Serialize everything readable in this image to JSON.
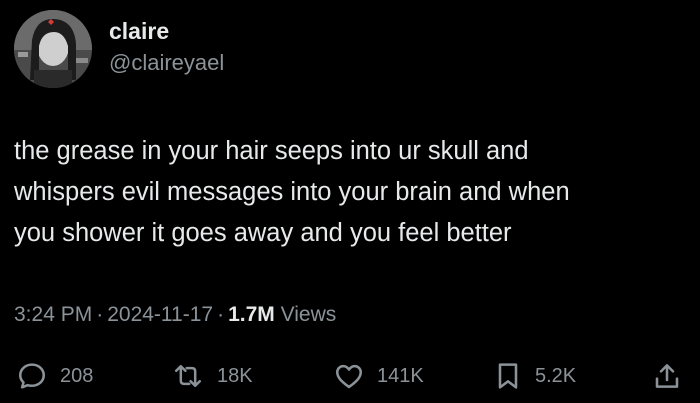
{
  "author": {
    "display_name": "claire",
    "handle": "@claireyael"
  },
  "tweet": {
    "lines": [
      "the grease in your hair seeps into ur skull and",
      "whispers evil messages into your brain and when",
      "you shower it goes away and you feel better"
    ],
    "time": "3:24 PM",
    "date": "2024-11-17",
    "separator": "·",
    "views_count": "1.7M",
    "views_label": "Views"
  },
  "actions": {
    "replies": "208",
    "reposts": "18K",
    "likes": "141K",
    "bookmarks": "5.2K"
  },
  "icons": {
    "reply": "speech-bubble-icon",
    "repost": "repost-arrows-icon",
    "like": "heart-icon",
    "bookmark": "bookmark-icon",
    "share": "share-upload-icon"
  },
  "colors": {
    "background": "#000000",
    "primary_text": "#e7e9ea",
    "secondary_text": "#8b9399"
  }
}
